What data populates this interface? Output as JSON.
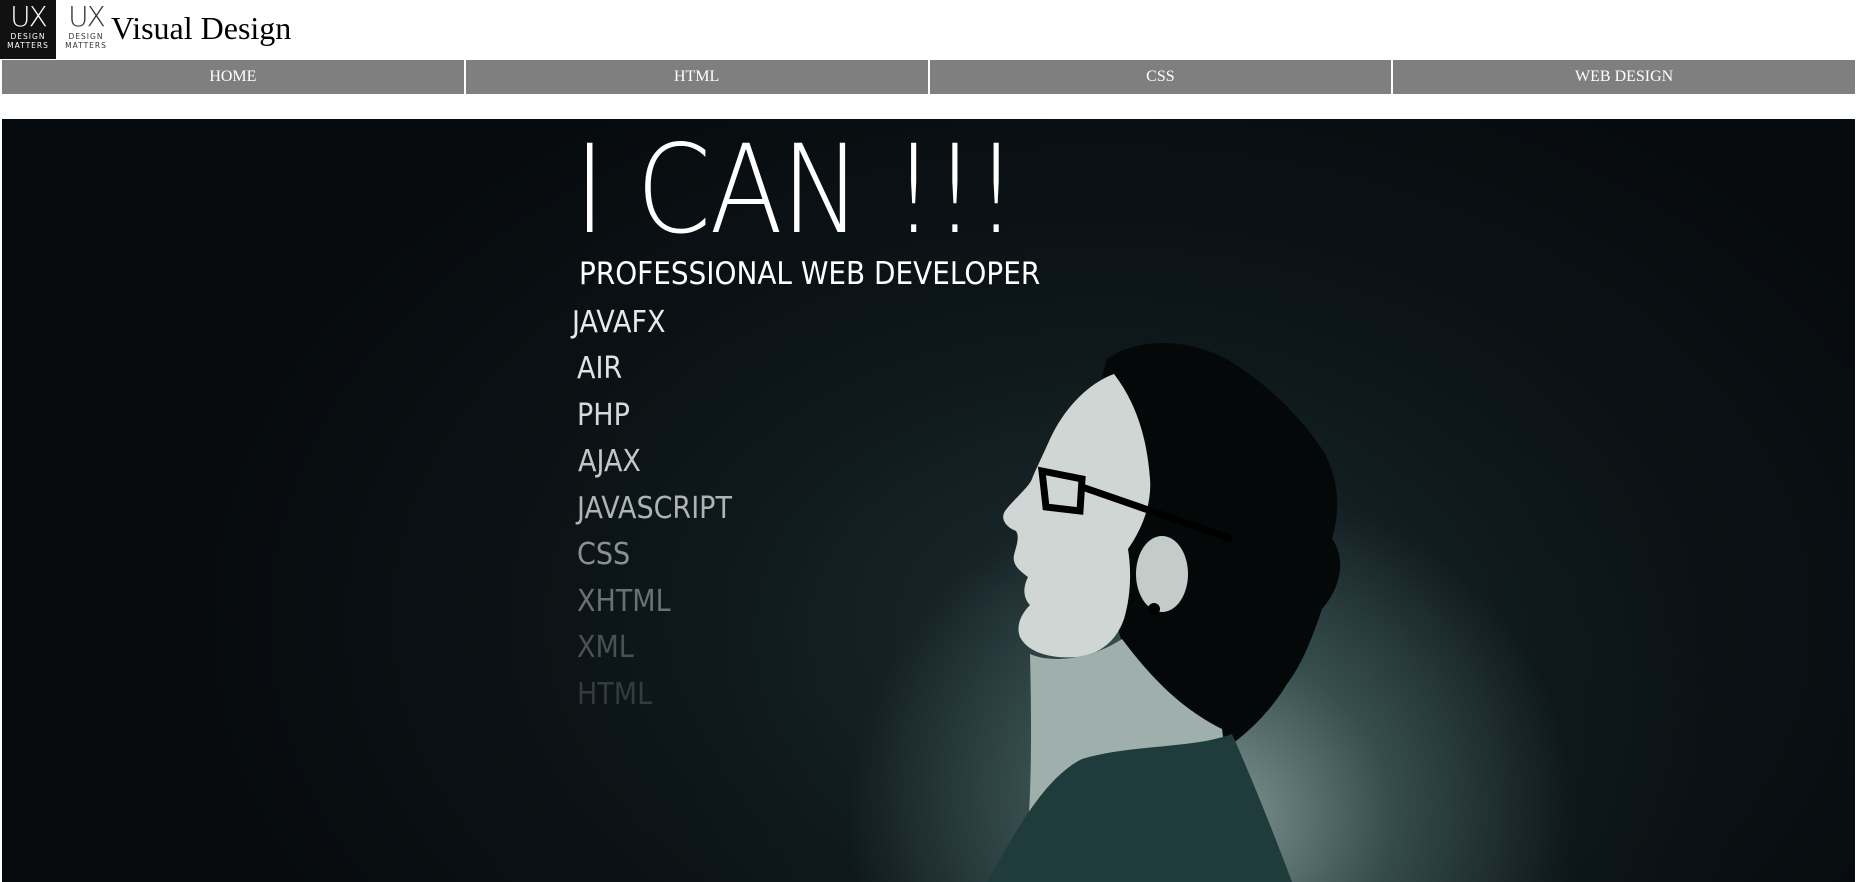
{
  "header": {
    "logo_text": "UX",
    "logo_subtext_1": "DESIGN",
    "logo_subtext_2": "MATTERS",
    "title": "Visual Design"
  },
  "nav": {
    "items": [
      {
        "label": "HOME"
      },
      {
        "label": "HTML"
      },
      {
        "label": "CSS"
      },
      {
        "label": "WEB DESIGN"
      }
    ]
  },
  "hero": {
    "headline": "I CAN !!!",
    "subheadline": "PROFESSIONAL WEB DEVELOPER",
    "skills": [
      "JAVAFX",
      "AIR",
      "PHP",
      "AJAX",
      "JAVASCRIPT",
      "CSS",
      "XHTML",
      "XML",
      "HTML"
    ],
    "colors": {
      "background": "#0a1114",
      "glow": "#8fb0aa",
      "text": "#ffffff"
    }
  }
}
